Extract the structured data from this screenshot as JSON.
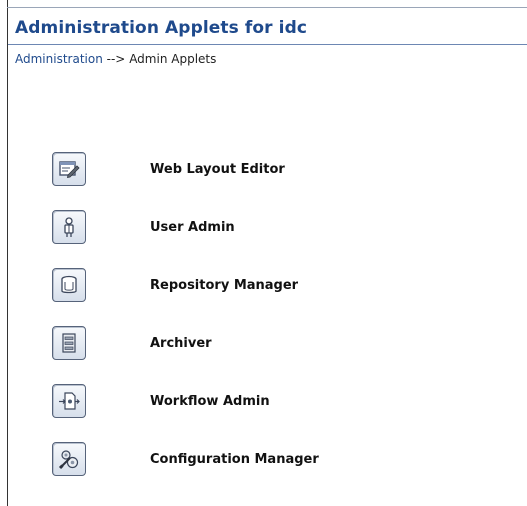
{
  "header": {
    "title": "Administration Applets for idc"
  },
  "breadcrumb": {
    "link": "Administration",
    "separator": "-->",
    "current": "Admin Applets"
  },
  "applets": [
    {
      "label": "Web Layout Editor",
      "icon": "web-layout-editor-icon"
    },
    {
      "label": "User Admin",
      "icon": "user-admin-icon"
    },
    {
      "label": "Repository Manager",
      "icon": "repository-manager-icon"
    },
    {
      "label": "Archiver",
      "icon": "archiver-icon"
    },
    {
      "label": "Workflow Admin",
      "icon": "workflow-admin-icon"
    },
    {
      "label": "Configuration Manager",
      "icon": "configuration-manager-icon"
    }
  ],
  "colors": {
    "title": "#1f4a8c",
    "link": "#1f4a8c",
    "rule": "#6d87b3"
  }
}
